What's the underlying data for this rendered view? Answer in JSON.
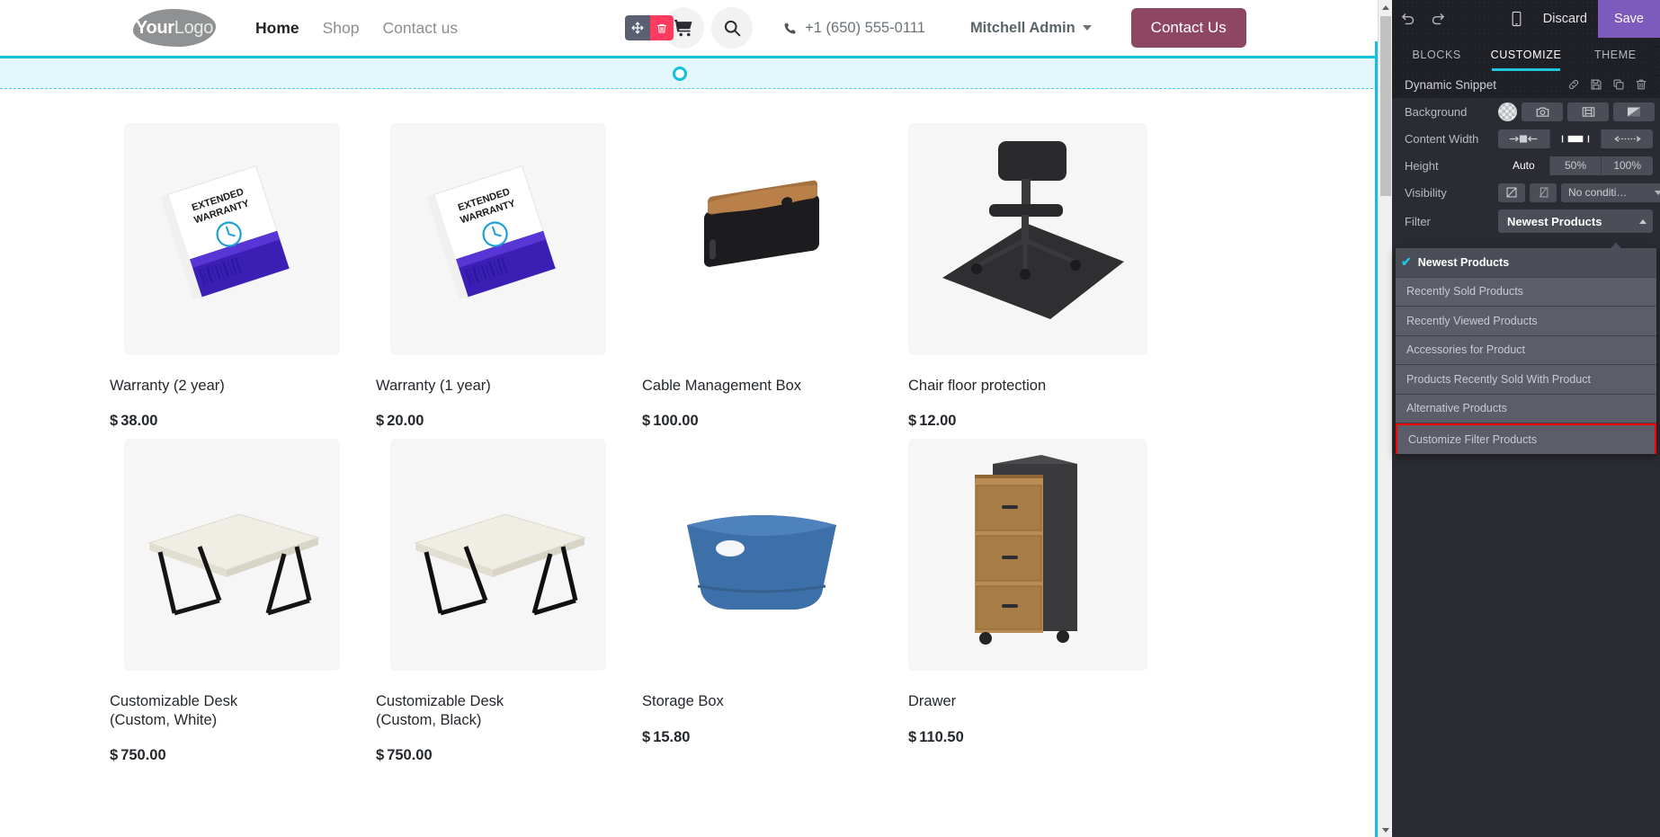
{
  "site": {
    "logo": {
      "bold": "Your",
      "light": "Logo"
    },
    "nav_links": [
      {
        "label": "Home",
        "active": true
      },
      {
        "label": "Shop",
        "active": false
      },
      {
        "label": "Contact us",
        "active": false
      }
    ],
    "cart_icon": "shopping-cart-icon",
    "search_icon": "search-icon",
    "edit_overlay": {
      "move_icon": "move-arrows-icon",
      "delete_icon": "trash-icon"
    },
    "phone_icon": "phone-icon",
    "phone": "+1 (650) 555-0111",
    "user": "Mitchell Admin",
    "cta": "Contact Us"
  },
  "products": [
    {
      "name": "Warranty (2 year)",
      "currency": "$",
      "price": "38.00",
      "image": "warranty-box-image"
    },
    {
      "name": "Warranty (1 year)",
      "currency": "$",
      "price": "20.00",
      "image": "warranty-box-image"
    },
    {
      "name": "Cable Management Box",
      "currency": "$",
      "price": "100.00",
      "image": "cable-management-box-image"
    },
    {
      "name": "Chair floor protection",
      "currency": "$",
      "price": "12.00",
      "image": "chair-floor-mat-image"
    },
    {
      "name": "Customizable Desk (Custom, White)",
      "currency": "$",
      "price": "750.00",
      "image": "desk-white-image"
    },
    {
      "name": "Customizable Desk (Custom, Black)",
      "currency": "$",
      "price": "750.00",
      "image": "desk-black-image"
    },
    {
      "name": "Storage Box",
      "currency": "$",
      "price": "15.80",
      "image": "storage-box-image"
    },
    {
      "name": "Drawer",
      "currency": "$",
      "price": "110.50",
      "image": "drawer-image"
    }
  ],
  "panel": {
    "toolbar": {
      "undo_icon": "undo-icon",
      "redo_icon": "redo-icon",
      "mobile_icon": "mobile-preview-icon",
      "discard": "Discard",
      "save": "Save",
      "save_color": "#7c5bbd"
    },
    "tabs": [
      {
        "label": "BLOCKS",
        "active": false
      },
      {
        "label": "CUSTOMIZE",
        "active": true
      },
      {
        "label": "THEME",
        "active": false
      }
    ],
    "accent_color": "#1fc4e0",
    "snippet": {
      "title": "Dynamic Snippet",
      "icons": [
        "link-icon",
        "save-disk-icon",
        "duplicate-icon",
        "trash-icon"
      ]
    },
    "options": {
      "background": {
        "label": "Background",
        "swatch_icon": "transparent-swatch-icon",
        "buttons": [
          "camera-icon",
          "video-icon",
          "gradient-icon"
        ]
      },
      "content_width": {
        "label": "Content Width",
        "buttons": [
          "narrow-icon",
          "normal-icon",
          "full-width-icon"
        ],
        "active_index": 1
      },
      "height": {
        "label": "Height",
        "options": [
          "Auto",
          "50%",
          "100%"
        ],
        "active_index": 0
      },
      "visibility": {
        "label": "Visibility",
        "buttons": [
          "visible-icon",
          "hidden-icon"
        ],
        "condition": "No conditi…"
      },
      "filter": {
        "label": "Filter",
        "value": "Newest Products",
        "menu_items": [
          {
            "label": "Newest Products",
            "selected": true,
            "highlight": false
          },
          {
            "label": "Recently Sold Products",
            "selected": false,
            "highlight": false
          },
          {
            "label": "Recently Viewed Products",
            "selected": false,
            "highlight": false
          },
          {
            "label": "Accessories for Product",
            "selected": false,
            "highlight": false
          },
          {
            "label": "Products Recently Sold With Product",
            "selected": false,
            "highlight": false
          },
          {
            "label": "Alternative Products",
            "selected": false,
            "highlight": false
          },
          {
            "label": "Customize Filter Products",
            "selected": false,
            "highlight": true
          }
        ],
        "highlight_color": "#ff0000"
      }
    }
  }
}
